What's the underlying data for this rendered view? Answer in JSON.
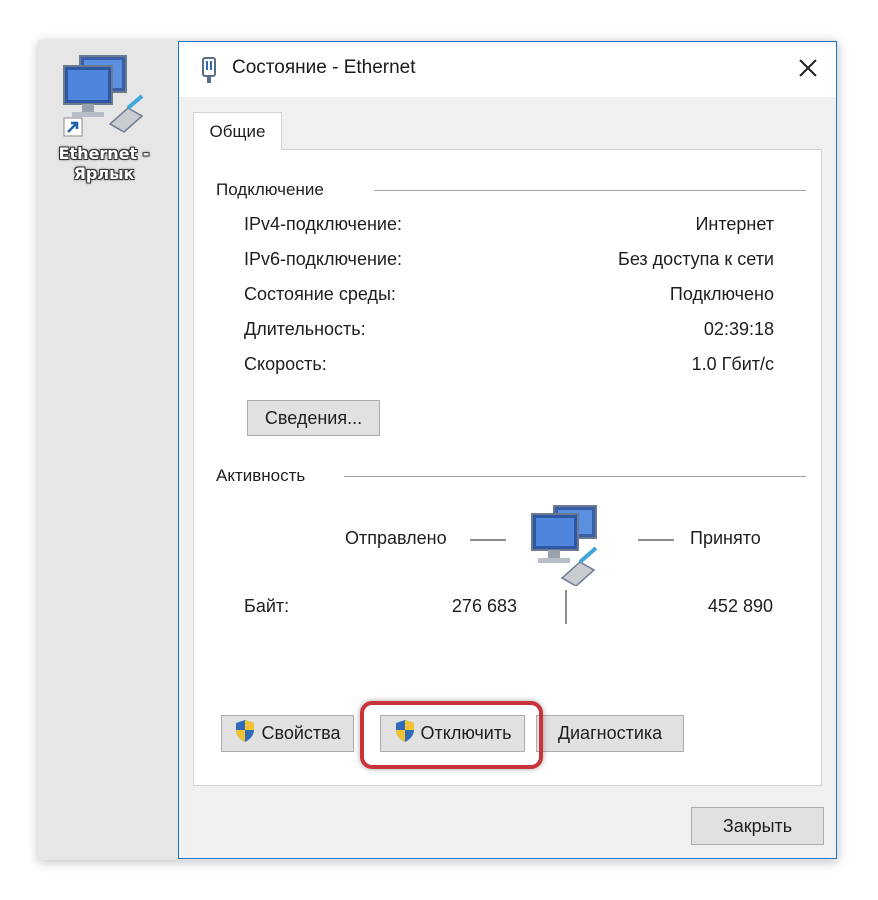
{
  "desktop": {
    "shortcut_label": "Ethernet - Ярлык",
    "shortcut_icon": "network-computers-icon"
  },
  "window": {
    "title": "Состояние - Ethernet",
    "title_icon": "ethernet-plug-icon",
    "close_icon": "close-icon",
    "tab_label": "Общие",
    "accent": "#1a73c7"
  },
  "connection": {
    "heading": "Подключение",
    "rows": [
      {
        "label": "IPv4-подключение:",
        "value": "Интернет"
      },
      {
        "label": "IPv6-подключение:",
        "value": "Без доступа к сети"
      },
      {
        "label": "Состояние среды:",
        "value": "Подключено"
      },
      {
        "label": "Длительность:",
        "value": "02:39:18"
      },
      {
        "label": "Скорость:",
        "value": "1.0 Гбит/с"
      }
    ],
    "details_button": "Сведения..."
  },
  "activity": {
    "heading": "Активность",
    "sent_label": "Отправлено",
    "received_label": "Принято",
    "bytes_label": "Байт:",
    "bytes_sent": "276 683",
    "bytes_received": "452 890"
  },
  "buttons": {
    "properties": "Свойства",
    "disable": "Отключить",
    "diagnose": "Диагностика",
    "close": "Закрыть",
    "highlight_color": "#c9343a"
  }
}
